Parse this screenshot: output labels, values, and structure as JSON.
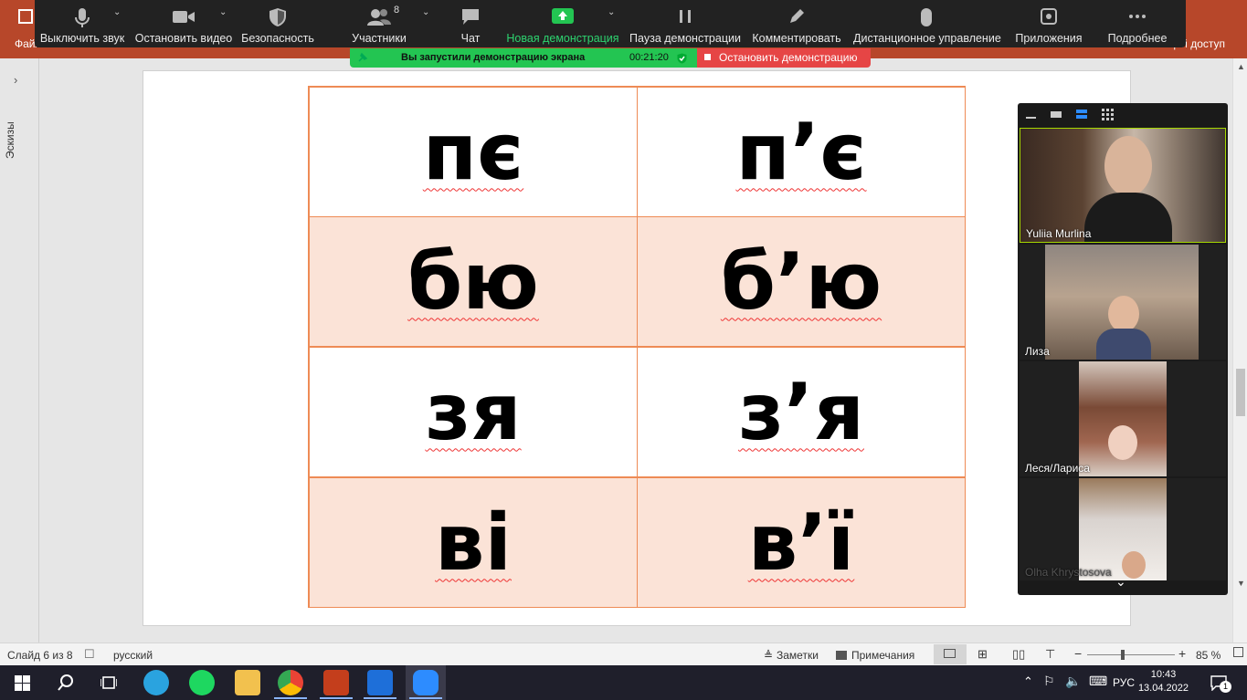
{
  "powerpoint": {
    "file_label": "Файл",
    "share_label": "Общий доступ",
    "thumbnails_label": "Эскизы",
    "status": {
      "slide_info": "Слайд 6 из 8",
      "language": "русский",
      "notes_label": "Заметки",
      "comments_label": "Примечания",
      "zoom_level": "85 %"
    }
  },
  "zoom_toolbar": {
    "mute_label": "Выключить звук",
    "stop_video_label": "Остановить видео",
    "security_label": "Безопасность",
    "participants_label": "Участники",
    "participants_count": "8",
    "chat_label": "Чат",
    "new_share_label": "Новая демонстрация",
    "pause_share_label": "Пауза демонстрации",
    "annotate_label": "Комментировать",
    "remote_control_label": "Дистанционное управление",
    "apps_label": "Приложения",
    "more_label": "Подробнее"
  },
  "share_banner": {
    "text": "Вы запустили демонстрацию экрана",
    "elapsed": "00:21:20",
    "stop_label": "Остановить демонстрацию"
  },
  "slide_table": {
    "rows": [
      [
        "пє",
        "п’є"
      ],
      [
        "бю",
        "б’ю"
      ],
      [
        "зя",
        "з’я"
      ],
      [
        "ві",
        "в’ї"
      ]
    ]
  },
  "video_panel": {
    "participants": [
      {
        "name": "Yuliia Murlina"
      },
      {
        "name": "Лиза"
      },
      {
        "name": "Леся/Лариса"
      },
      {
        "name": "Olha Khrystosova"
      }
    ]
  },
  "taskbar": {
    "language": "РУС",
    "time": "10:43",
    "date": "13.04.2022",
    "notification_count": "1"
  },
  "colors": {
    "table_border": "#ee8b55",
    "table_shade": "#fbe3d7",
    "share_green": "#23c552",
    "stop_red": "#e64545"
  }
}
